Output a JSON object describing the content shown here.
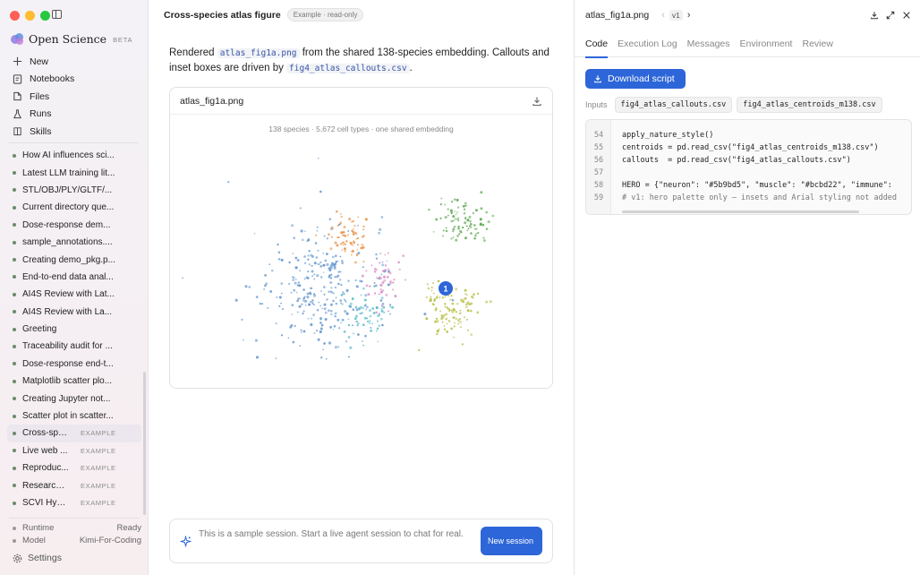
{
  "app": {
    "brand": "Open Science",
    "brand_badge": "BETA"
  },
  "sidebar": {
    "nav": [
      {
        "label": "New",
        "icon": "plus-icon"
      },
      {
        "label": "Notebooks",
        "icon": "notebook-icon"
      },
      {
        "label": "Files",
        "icon": "files-icon"
      },
      {
        "label": "Runs",
        "icon": "flask-icon"
      },
      {
        "label": "Skills",
        "icon": "book-icon"
      }
    ],
    "sessions": [
      {
        "label": "How AI influences sci...",
        "tag": ""
      },
      {
        "label": "Latest LLM training lit...",
        "tag": ""
      },
      {
        "label": "STL/OBJ/PLY/GLTF/...",
        "tag": ""
      },
      {
        "label": "Current directory que...",
        "tag": ""
      },
      {
        "label": "Dose-response dem...",
        "tag": ""
      },
      {
        "label": "sample_annotations....",
        "tag": ""
      },
      {
        "label": "Creating demo_pkg.p...",
        "tag": ""
      },
      {
        "label": "End-to-end data anal...",
        "tag": ""
      },
      {
        "label": "AI4S Review with Lat...",
        "tag": ""
      },
      {
        "label": "AI4S Review with La...",
        "tag": ""
      },
      {
        "label": "Greeting",
        "tag": ""
      },
      {
        "label": "Traceability audit for ...",
        "tag": ""
      },
      {
        "label": "Dose-response end-t...",
        "tag": ""
      },
      {
        "label": "Matplotlib scatter plo...",
        "tag": ""
      },
      {
        "label": "Creating Jupyter not...",
        "tag": ""
      },
      {
        "label": "Scatter plot in scatter...",
        "tag": ""
      },
      {
        "label": "Cross-spe...",
        "tag": "EXAMPLE",
        "active": true
      },
      {
        "label": "Live web ...",
        "tag": "EXAMPLE"
      },
      {
        "label": "Reproduc...",
        "tag": "EXAMPLE"
      },
      {
        "label": "Research ...",
        "tag": "EXAMPLE"
      },
      {
        "label": "SCVI Hyp...",
        "tag": "EXAMPLE"
      }
    ],
    "status": [
      {
        "label": "Runtime",
        "value": "Ready"
      },
      {
        "label": "Model",
        "value": "Kimi-For-Coding"
      }
    ],
    "settings_label": "Settings"
  },
  "main": {
    "title": "Cross-species atlas figure",
    "chip": "Example · read-only",
    "message": {
      "p1": "Rendered ",
      "file1": "atlas_fig1a.png",
      "p2": " from the shared 138-species embedding. Callouts and inset boxes are driven by ",
      "file2": "fig4_atlas_callouts.csv",
      "p3": "."
    },
    "figure": {
      "name": "atlas_fig1a.png",
      "subtitle": "138 species · 5,672 cell types · one shared embedding",
      "callout": "1"
    },
    "chat": {
      "placeholder": "This is a sample session. Start a live agent session to chat for real.",
      "button": "New session"
    }
  },
  "panel": {
    "title": "atlas_fig1a.png",
    "version": "v1",
    "tabs": [
      "Code",
      "Execution Log",
      "Messages",
      "Environment",
      "Review"
    ],
    "active_tab": "Code",
    "download_label": "Download script",
    "inputs_label": "Inputs",
    "inputs": [
      "fig4_atlas_callouts.csv",
      "fig4_atlas_centroids_m138.csv"
    ],
    "code": [
      {
        "n": "54",
        "text": "apply_nature_style()"
      },
      {
        "n": "55",
        "text": "centroids = pd.read_csv(\"fig4_atlas_centroids_m138.csv\")"
      },
      {
        "n": "56",
        "text": "callouts  = pd.read_csv(\"fig4_atlas_callouts.csv\")"
      },
      {
        "n": "57",
        "text": ""
      },
      {
        "n": "58",
        "text": "HERO = {\"neuron\": \"#5b9bd5\", \"muscle\": \"#bcbd22\", \"immune\":"
      },
      {
        "n": "59",
        "text": "# v1: hero palette only — insets and Arial styling not added"
      }
    ]
  },
  "colors": {
    "accent": "#2d66d8",
    "clusters": [
      "#6b9bd1",
      "#e8944a",
      "#d98fc7",
      "#58bcc9",
      "#62aa55",
      "#b8bf45"
    ]
  }
}
